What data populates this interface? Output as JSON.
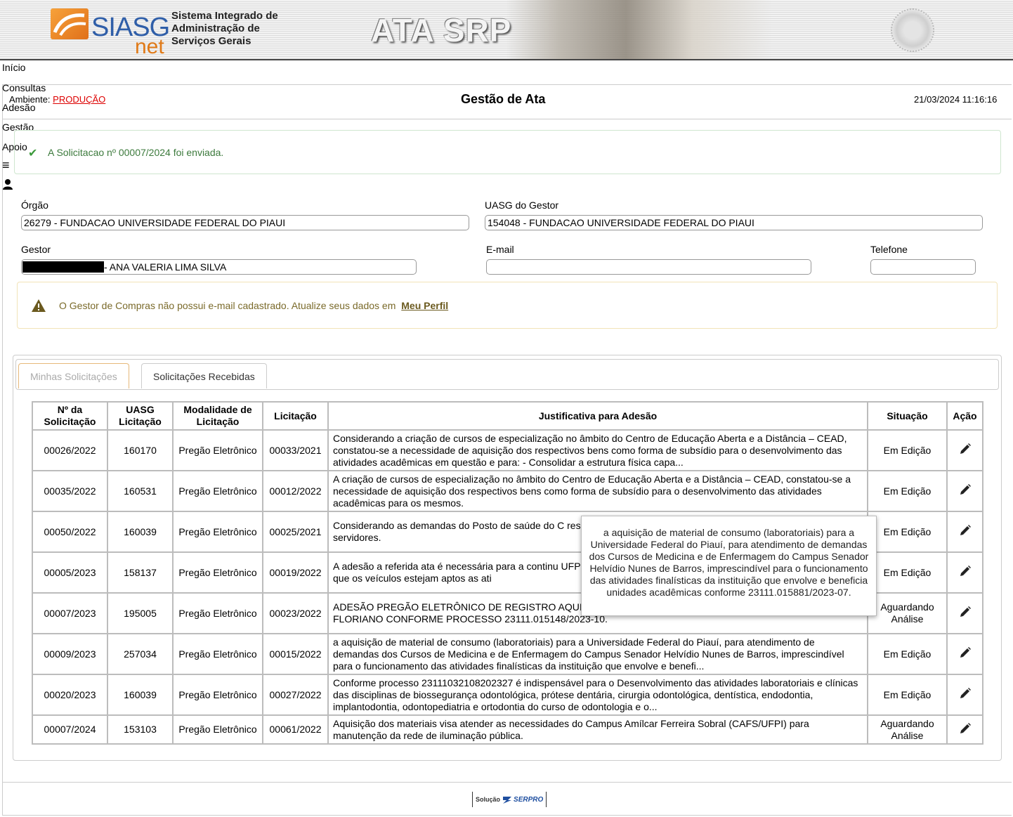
{
  "header": {
    "logo_main": "SIASG",
    "logo_sub": "net",
    "system_name_lines": [
      "Sistema Integrado de",
      "Administração de",
      "Serviços Gerais"
    ],
    "app_title": "ATA SRP"
  },
  "menu": {
    "items": [
      "Início",
      "Consultas",
      "Adesão",
      "Gestão",
      "Apoio"
    ]
  },
  "env": {
    "label": "Ambiente:",
    "value": "PRODUÇÃO",
    "value_color": "#dd0000"
  },
  "page_title": "Gestão de Ata",
  "datetime": "21/03/2024 11:16:16",
  "success_message": "A Solicitacao nº 00007/2024 foi enviada.",
  "form": {
    "orgao_label": "Órgão",
    "orgao_value": "26279 - FUNDACAO UNIVERSIDADE FEDERAL DO PIAUI",
    "uasg_label": "UASG do Gestor",
    "uasg_value": "154048 - FUNDACAO UNIVERSIDADE FEDERAL DO PIAUI",
    "gestor_label": "Gestor",
    "gestor_value": "- ANA VALERIA LIMA SILVA",
    "email_label": "E-mail",
    "email_value": "",
    "telefone_label": "Telefone",
    "telefone_value": ""
  },
  "warning": {
    "text": "O Gestor de Compras não possui e-mail cadastrado. Atualize seus dados em",
    "link": "Meu Perfil"
  },
  "tabs": [
    "Minhas Solicitações",
    "Solicitações Recebidas"
  ],
  "table": {
    "headers": [
      "Nº da Solicitação",
      "UASG Licitação",
      "Modalidade de Licitação",
      "Licitação",
      "Justificativa para Adesão",
      "Situação",
      "Ação"
    ],
    "rows": [
      {
        "num": "00026/2022",
        "uasg": "160170",
        "modalidade": "Pregão Eletrônico",
        "licitacao": "00033/2021",
        "justificativa": "Considerando a criação de cursos de especialização no âmbito do Centro de Educação Aberta e a Distância – CEAD, constatou-se a necessidade de aquisição dos respectivos bens como forma de subsídio para o desenvolvimento das atividades acadêmicas em questão e para: - Consolidar a estrutura física capa...",
        "situacao": "Em Edição"
      },
      {
        "num": "00035/2022",
        "uasg": "160531",
        "modalidade": "Pregão Eletrônico",
        "licitacao": "00012/2022",
        "justificativa": "A criação de cursos de especialização no âmbito do Centro de Educação Aberta e a Distância – CEAD, constatou-se a necessidade de aquisição dos respectivos bens como forma de subsídio para o desenvolvimento das atividades acadêmicas para os mesmos.",
        "situacao": "Em Edição"
      },
      {
        "num": "00050/2022",
        "uasg": "160039",
        "modalidade": "Pregão Eletrônico",
        "licitacao": "00025/2021",
        "justificativa": "Considerando as demandas do Posto de saúde do C respectivos bens como forma de subsídio para o de docentes e servidores.",
        "situacao": "Em Edição"
      },
      {
        "num": "00005/2023",
        "uasg": "158137",
        "modalidade": "Pregão Eletrônico",
        "licitacao": "00019/2022",
        "justificativa": "A adesão a referida ata é necessária para a continu UFPI, como servidores devemos zelar pelo patrimôn para a garantir que os veículos estejam aptos as ati",
        "situacao": "Em Edição"
      },
      {
        "num": "00007/2023",
        "uasg": "195005",
        "modalidade": "Pregão Eletrônico",
        "licitacao": "00023/2022",
        "justificativa": "ADESÃO PREGÃO ELETRÔNICO DE REGISTRO AQUISIÇÃO DE 01 MÁQUINA PICADEIRA ENSILA TÉCNICO DE FLORIANO CONFORME PROCESSO 23111.015148/2023-10.",
        "situacao": "Aguardando Análise"
      },
      {
        "num": "00009/2023",
        "uasg": "257034",
        "modalidade": "Pregão Eletrônico",
        "licitacao": "00015/2022",
        "justificativa": "a aquisição de material de consumo (laboratoriais) para a Universidade Federal do Piauí, para atendimento de demandas dos Cursos de Medicina e de Enfermagem do Campus Senador Helvídio Nunes de Barros, imprescindível para o funcionamento das atividades finalísticas da instituição que envolve e benefi...",
        "situacao": "Em Edição"
      },
      {
        "num": "00020/2023",
        "uasg": "160039",
        "modalidade": "Pregão Eletrônico",
        "licitacao": "00027/2022",
        "justificativa": "Conforme processo 23111032108202327 é indispensável para o Desenvolvimento das atividades laboratoriais e clínicas das disciplinas de biossegurança odontológica, prótese dentária, cirurgia odontológica, dentística, endodontia, implantodontia, odontopediatria e ortodontia do curso de odontologia e o...",
        "situacao": "Em Edição"
      },
      {
        "num": "00007/2024",
        "uasg": "153103",
        "modalidade": "Pregão Eletrônico",
        "licitacao": "00061/2022",
        "justificativa": "Aquisição dos materiais visa atender as necessidades do Campus Amílcar Ferreira Sobral (CAFS/UFPI) para manutenção da rede de iluminação pública.",
        "situacao": "Aguardando Análise"
      }
    ]
  },
  "tooltip": "a aquisição de material de consumo (laboratoriais) para a Universidade Federal do Piauí, para atendimento de demandas dos Cursos de Medicina e de Enfermagem do Campus Senador Helvídio Nunes de Barros, imprescindível para o funcionamento das atividades finalísticas da instituição que envolve e beneficia unidades acadêmicas conforme 23111.015881/2023-07.",
  "footer": {
    "prefix": "Solução",
    "brand": "SERPRO"
  },
  "icons": {
    "success": "check-icon",
    "warning": "warning-triangle-icon",
    "action": "pencil-icon",
    "menu": "hamburger-icon",
    "user": "user-icon"
  }
}
